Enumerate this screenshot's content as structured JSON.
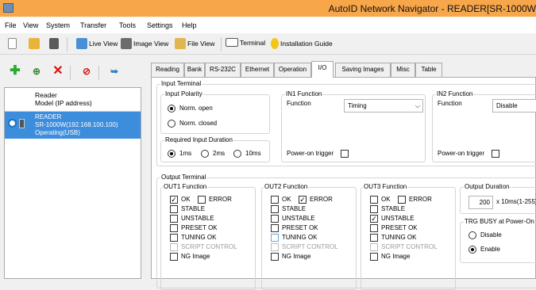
{
  "window": {
    "title": "AutoID Network Navigator - READER[SR-1000W"
  },
  "menu": [
    "File",
    "View",
    "System",
    "Transfer",
    "Tools",
    "Settings",
    "Help"
  ],
  "toolbar": {
    "live_view": "Live View",
    "image_view": "Image View",
    "file_view": "File View",
    "terminal": "Terminal",
    "installation_guide": "Installation Guide"
  },
  "tree": {
    "header_line1": "Reader",
    "header_line2": "Model (IP address)",
    "item_line1": "READER",
    "item_line2": "SR-1000W(192.168.100.100)",
    "item_line3": "Operating(USB)"
  },
  "tabs": [
    "Reading",
    "Bank",
    "RS-232C",
    "Ethernet",
    "Operation",
    "I/O",
    "Saving Images",
    "Misc",
    "Table"
  ],
  "active_tab": "I/O",
  "input_terminal": {
    "label": "Input Terminal",
    "polarity": {
      "label": "Input Polarity",
      "open": "Norm. open",
      "closed": "Norm. closed",
      "selected": "Norm. open"
    },
    "duration": {
      "label": "Required Input Duration",
      "options": [
        "1ms",
        "2ms",
        "10ms"
      ],
      "selected": "1ms"
    },
    "in1": {
      "label": "IN1 Function",
      "function_label": "Function",
      "value": "Timing",
      "power_on": "Power-on trigger"
    },
    "in2": {
      "label": "IN2 Function",
      "function_label": "Function",
      "value": "Disable",
      "power_on": "Power-on trigger"
    }
  },
  "output_terminal": {
    "label": "Output Terminal",
    "out1": {
      "label": "OUT1 Function",
      "ok": "OK",
      "error": "ERROR",
      "stable": "STABLE",
      "unstable": "UNSTABLE",
      "preset": "PRESET OK",
      "tuning": "TUNING OK",
      "script": "SCRIPT CONTROL",
      "ng": "NG Image"
    },
    "out2": {
      "label": "OUT2 Function",
      "ok": "OK",
      "error": "ERROR",
      "stable": "STABLE",
      "unstable": "UNSTABLE",
      "preset": "PRESET OK",
      "tuning": "TUNING OK",
      "script": "SCRIPT CONTROL",
      "ng": "NG Image"
    },
    "out3": {
      "label": "OUT3 Function",
      "ok": "OK",
      "error": "ERROR",
      "stable": "STABLE",
      "unstable": "UNSTABLE",
      "preset": "PRESET OK",
      "tuning": "TUNING OK",
      "script": "SCRIPT CONTROL",
      "ng": "NG Image"
    },
    "duration": {
      "label": "Output Duration",
      "value": "200",
      "unit": "x 10ms(1-255)"
    },
    "trg_busy": {
      "label": "TRG BUSY at Power-On",
      "disable": "Disable",
      "enable": "Enable",
      "selected": "Enable"
    }
  },
  "checks": {
    "out1": {
      "ok": true,
      "error": false,
      "stable": false,
      "unstable": false,
      "preset": false,
      "tuning": false,
      "script": false,
      "ng": false
    },
    "out2": {
      "ok": false,
      "error": true,
      "stable": false,
      "unstable": false,
      "preset": false,
      "tuning": false,
      "script": false,
      "ng": false
    },
    "out3": {
      "ok": false,
      "error": false,
      "stable": false,
      "unstable": true,
      "preset": false,
      "tuning": false,
      "script": false,
      "ng": false
    }
  },
  "colors": {
    "titlebar": "#f7a64a",
    "selection": "#3c8ddc"
  }
}
